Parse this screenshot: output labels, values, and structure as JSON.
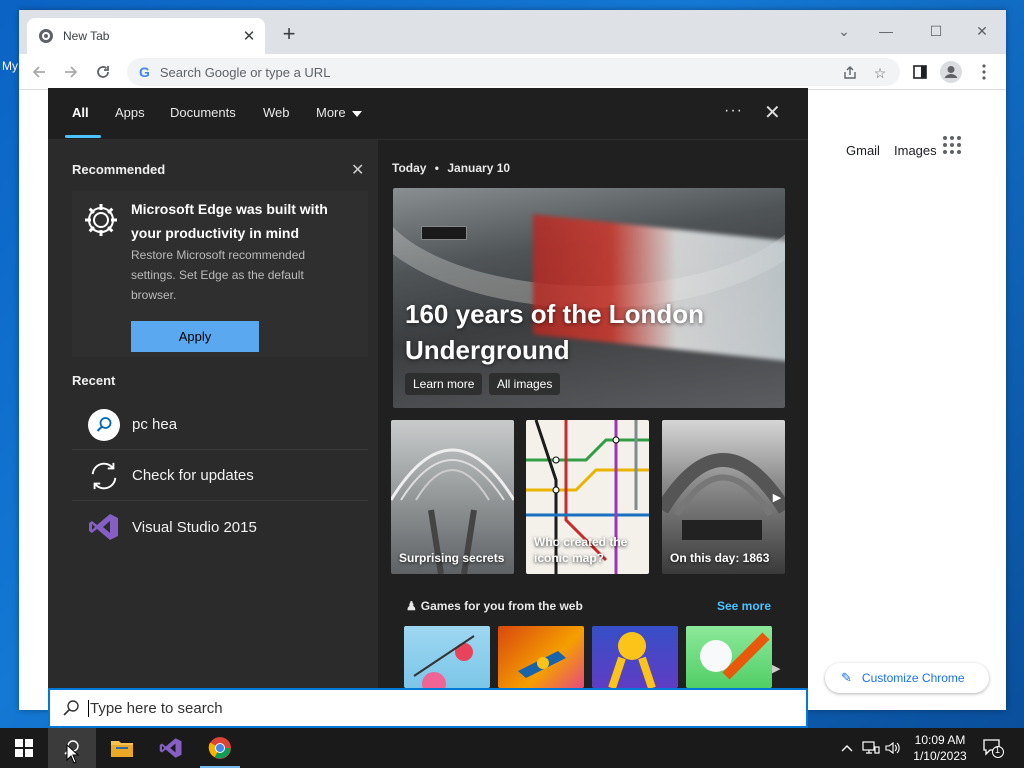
{
  "desktop": {
    "label": "My"
  },
  "chrome": {
    "tab_title": "New Tab",
    "tab_close": "✕",
    "new_tab": "+",
    "window_controls": {
      "dropdown": "⌄",
      "minimize": "—",
      "maximize": "☐",
      "close": "✕"
    },
    "omnibox_placeholder": "Search Google or type a URL",
    "ntp_links": {
      "gmail": "Gmail",
      "images": "Images"
    },
    "customize_label": "Customize Chrome"
  },
  "search_panel": {
    "tabs": {
      "all": "All",
      "apps": "Apps",
      "documents": "Documents",
      "web": "Web",
      "more": "More"
    },
    "dots": "···",
    "close": "✕",
    "recommended_title": "Recommended",
    "recommended_close": "✕",
    "recommended": {
      "title": "Microsoft Edge was built with your productivity in mind",
      "description": "Restore Microsoft recommended settings. Set Edge as the default browser.",
      "button": "Apply"
    },
    "recent_title": "Recent",
    "recent": [
      {
        "label": "pc hea",
        "icon": "search-icon"
      },
      {
        "label": "Check for updates",
        "icon": "sync-icon"
      },
      {
        "label": "Visual Studio 2015",
        "icon": "visual-studio-icon"
      }
    ],
    "today": {
      "day": "Today",
      "bullet": "•",
      "date": "January 10"
    },
    "hero": {
      "title": "160 years of the London Underground",
      "learn_more": "Learn more",
      "all_images": "All images"
    },
    "tiles": [
      {
        "label": "Surprising secrets"
      },
      {
        "label": "Who created the iconic map?"
      },
      {
        "label": "On this day: 1863"
      }
    ],
    "games_title": "Games for you from the web",
    "see_more": "See more"
  },
  "searchbox": {
    "placeholder": "Type here to search"
  },
  "taskbar": {
    "clock_time": "10:09 AM",
    "clock_date": "1/10/2023",
    "notification_count": "1"
  },
  "colors": {
    "accent": "#0078d7",
    "link": "#4cc2ff",
    "apply": "#5aa9f0"
  }
}
